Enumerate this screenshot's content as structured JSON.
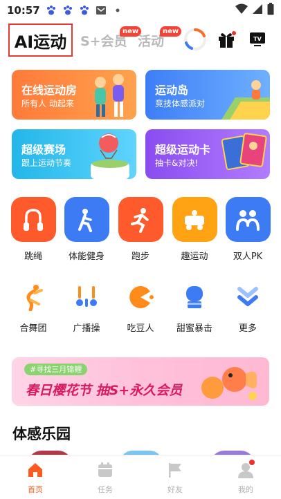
{
  "status_bar": {
    "time": "10:57",
    "icons": [
      "baidu-paw-icon",
      "baidu-paw-icon",
      "baidu-paw-icon",
      "mail-icon",
      "dot-icon",
      "wifi-icon",
      "signal-icon",
      "battery-icon"
    ]
  },
  "header": {
    "tabs": [
      {
        "label": "AI运动",
        "active": true
      },
      {
        "label": "S+会员",
        "badge": "new"
      },
      {
        "label": "活动",
        "badge": "new"
      }
    ],
    "icons": [
      "ring-progress-icon",
      "gift-icon",
      "tv-icon"
    ]
  },
  "cards": [
    {
      "title": "在线运动房",
      "subtitle": "所有人 动起来",
      "color": "#ff8a3d"
    },
    {
      "title": "运动岛",
      "subtitle": "竞技体感派对",
      "color": "#4a8cf7"
    },
    {
      "title": "超级赛场",
      "subtitle": "跟上运动节奏",
      "color": "#2fbcec"
    },
    {
      "title": "超级运动卡",
      "subtitle": "抽卡&对决!",
      "color": "#9a5cf5"
    }
  ],
  "categories": [
    {
      "label": "跳绳",
      "icon": "jump-rope-icon",
      "color": "#ff5a2c"
    },
    {
      "label": "体能健身",
      "icon": "fitness-person-icon",
      "color": "#3d7bf5"
    },
    {
      "label": "跑步",
      "icon": "running-person-icon",
      "color": "#ff5a2c"
    },
    {
      "label": "趣运动",
      "icon": "fun-cart-icon",
      "color": "#ffa313"
    },
    {
      "label": "双人PK",
      "icon": "two-people-icon",
      "color": "#3d7bf5"
    }
  ],
  "games": [
    {
      "label": "合舞团",
      "icon": "dance-icon"
    },
    {
      "label": "广播操",
      "icon": "exercise-icon"
    },
    {
      "label": "吃豆人",
      "icon": "pacman-icon"
    },
    {
      "label": "甜蜜暴击",
      "icon": "boxing-glove-icon"
    },
    {
      "label": "更多",
      "icon": "more-chevron-icon"
    }
  ],
  "promo": {
    "tag": "#寻找三月锦鲤",
    "text": "春日樱花节  抽S+永久会员"
  },
  "section": {
    "title": "体感乐园"
  },
  "bottom_nav": [
    {
      "label": "首页",
      "icon": "home-icon",
      "active": true
    },
    {
      "label": "任务",
      "icon": "calendar-icon"
    },
    {
      "label": "好友",
      "icon": "flag-icon"
    },
    {
      "label": "我的",
      "icon": "profile-icon",
      "dot": true
    }
  ],
  "colors": {
    "accent": "#ff5a1f",
    "highlight_border": "#e53935",
    "badge": "#f44336"
  }
}
